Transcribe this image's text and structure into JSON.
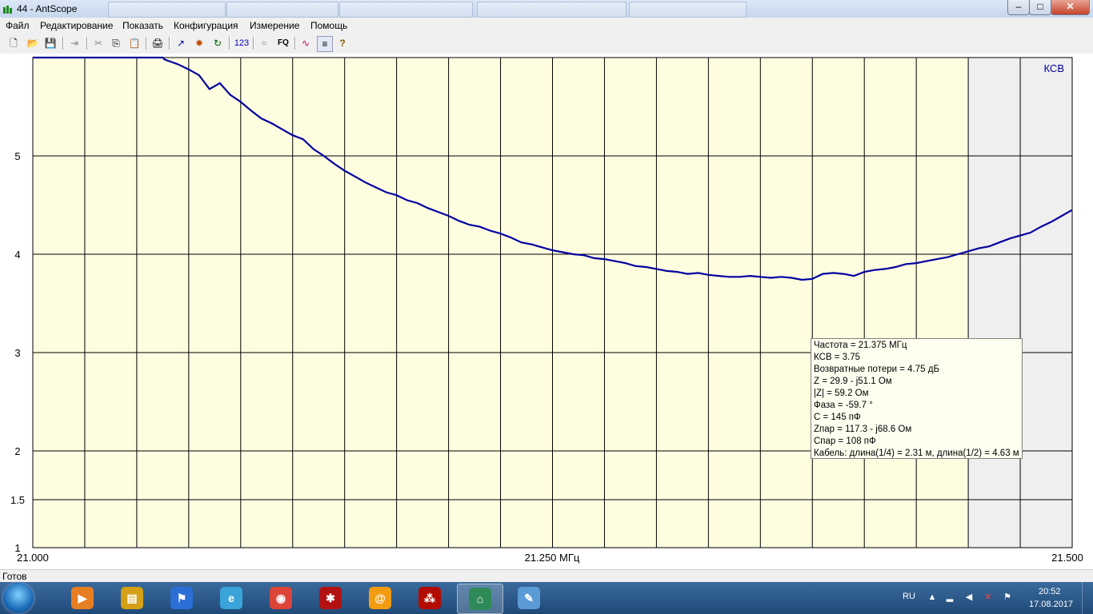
{
  "window": {
    "title": "44 - AntScope",
    "min_glyph": "–",
    "max_glyph": "□",
    "close_glyph": "✕"
  },
  "menu": {
    "items": [
      "Файл",
      "Редактирование",
      "Показать",
      "Конфигурация",
      "Измерение",
      "Помощь"
    ]
  },
  "toolbar": {
    "tools": [
      {
        "name": "new-icon",
        "glyph": "🗋"
      },
      {
        "name": "open-icon",
        "glyph": "📂"
      },
      {
        "name": "save-icon",
        "glyph": "💾"
      },
      {
        "name": "export-icon",
        "glyph": "⇥"
      },
      {
        "name": "cut-icon",
        "glyph": "✂"
      },
      {
        "name": "copy-icon",
        "glyph": "⎘"
      },
      {
        "name": "paste-icon",
        "glyph": "📋"
      },
      {
        "name": "print-icon",
        "glyph": "🖨"
      },
      {
        "name": "graph-icon",
        "glyph": "↗"
      },
      {
        "name": "scan-icon",
        "glyph": "✸"
      },
      {
        "name": "refresh-icon",
        "glyph": "↻"
      },
      {
        "name": "numbers-icon",
        "glyph": "123"
      },
      {
        "name": "wireless-icon",
        "glyph": "≈"
      },
      {
        "name": "frequency-icon",
        "glyph": "FQ"
      },
      {
        "name": "curves-icon",
        "glyph": "∿"
      },
      {
        "name": "settings-icon",
        "glyph": "≡"
      },
      {
        "name": "help-icon",
        "glyph": "?"
      }
    ]
  },
  "chart_data": {
    "type": "line",
    "series_label": "КСВ",
    "xlim": [
      21.0,
      21.5
    ],
    "x_ticks": [
      "21.000",
      "21.250 МГц",
      "21.500"
    ],
    "y_ticks": [
      "1",
      "1.5",
      "2",
      "3",
      "4",
      "5"
    ],
    "y_scale": "swr",
    "ylim": [
      1,
      6
    ],
    "grid": true,
    "grid_x_divisions": 20,
    "plot_background": "#fffde0",
    "outside_band_background": "#efefef",
    "band_limit_mhz": 21.45,
    "line_color": "#0000a0",
    "x": [
      21.0,
      21.0625,
      21.0635,
      21.07,
      21.075,
      21.08,
      21.085,
      21.09,
      21.095,
      21.1,
      21.105,
      21.11,
      21.115,
      21.12,
      21.125,
      21.13,
      21.135,
      21.14,
      21.145,
      21.15,
      21.155,
      21.16,
      21.165,
      21.17,
      21.175,
      21.18,
      21.185,
      21.19,
      21.195,
      21.2,
      21.205,
      21.21,
      21.215,
      21.22,
      21.225,
      21.23,
      21.235,
      21.24,
      21.245,
      21.25,
      21.255,
      21.26,
      21.265,
      21.27,
      21.275,
      21.28,
      21.285,
      21.29,
      21.295,
      21.3,
      21.305,
      21.31,
      21.315,
      21.32,
      21.325,
      21.33,
      21.335,
      21.34,
      21.345,
      21.35,
      21.355,
      21.36,
      21.365,
      21.37,
      21.375,
      21.38,
      21.385,
      21.39,
      21.395,
      21.4,
      21.405,
      21.41,
      21.415,
      21.42,
      21.425,
      21.43,
      21.435,
      21.44,
      21.445,
      21.45,
      21.455,
      21.46,
      21.465,
      21.47,
      21.475,
      21.48,
      21.485,
      21.49,
      21.495,
      21.5
    ],
    "values": [
      6.0,
      6.0,
      5.98,
      5.93,
      5.88,
      5.82,
      5.68,
      5.74,
      5.62,
      5.55,
      5.46,
      5.38,
      5.33,
      5.27,
      5.21,
      5.17,
      5.07,
      5.0,
      4.92,
      4.85,
      4.79,
      4.73,
      4.68,
      4.63,
      4.6,
      4.55,
      4.52,
      4.47,
      4.43,
      4.39,
      4.34,
      4.3,
      4.28,
      4.24,
      4.21,
      4.17,
      4.12,
      4.1,
      4.07,
      4.04,
      4.02,
      4.0,
      3.99,
      3.96,
      3.95,
      3.93,
      3.91,
      3.88,
      3.87,
      3.85,
      3.83,
      3.82,
      3.8,
      3.81,
      3.79,
      3.78,
      3.77,
      3.77,
      3.78,
      3.77,
      3.76,
      3.77,
      3.76,
      3.74,
      3.75,
      3.8,
      3.81,
      3.8,
      3.78,
      3.82,
      3.84,
      3.85,
      3.87,
      3.9,
      3.91,
      3.93,
      3.95,
      3.97,
      4.0,
      4.03,
      4.06,
      4.08,
      4.12,
      4.16,
      4.19,
      4.22,
      4.28,
      4.33,
      4.39,
      4.45
    ]
  },
  "readout": {
    "lines": [
      "Частота = 21.375 МГц",
      "КСВ = 3.75",
      "Возвратные потери = 4.75 дБ",
      "Z = 29.9 - j51.1 Ом",
      "|Z| = 59.2 Ом",
      "Фаза = -59.7 °",
      "C = 145 пФ",
      "Zпар = 117.3 - j68.6 Ом",
      "Cпар = 108 пФ",
      "Кабель: длина(1/4) = 2.31 м, длина(1/2) = 4.63 м"
    ]
  },
  "status": {
    "text": "Готов"
  },
  "taskbar": {
    "apps": [
      {
        "name": "media-player-icon",
        "glyph": "▶",
        "color": "#e67e22"
      },
      {
        "name": "file-manager-icon",
        "glyph": "▤",
        "color": "#d4a017"
      },
      {
        "name": "messenger-icon",
        "glyph": "⚑",
        "color": "#2b6fd6"
      },
      {
        "name": "browser-ie-icon",
        "glyph": "e",
        "color": "#3aa3d9"
      },
      {
        "name": "chrome-icon",
        "glyph": "◉",
        "color": "#db4437"
      },
      {
        "name": "game-icon",
        "glyph": "✱",
        "color": "#b31212"
      },
      {
        "name": "mail-icon",
        "glyph": "@",
        "color": "#f39c12"
      },
      {
        "name": "pdf-reader-icon",
        "glyph": "⁂",
        "color": "#b30b00"
      },
      {
        "name": "antscope-icon",
        "glyph": "⌂",
        "color": "#2e8b57",
        "active": true
      },
      {
        "name": "paint-icon",
        "glyph": "✎",
        "color": "#5b9bd5"
      }
    ],
    "tray": {
      "lang": "RU",
      "time": "20:52",
      "date": "17.08.2017"
    }
  }
}
